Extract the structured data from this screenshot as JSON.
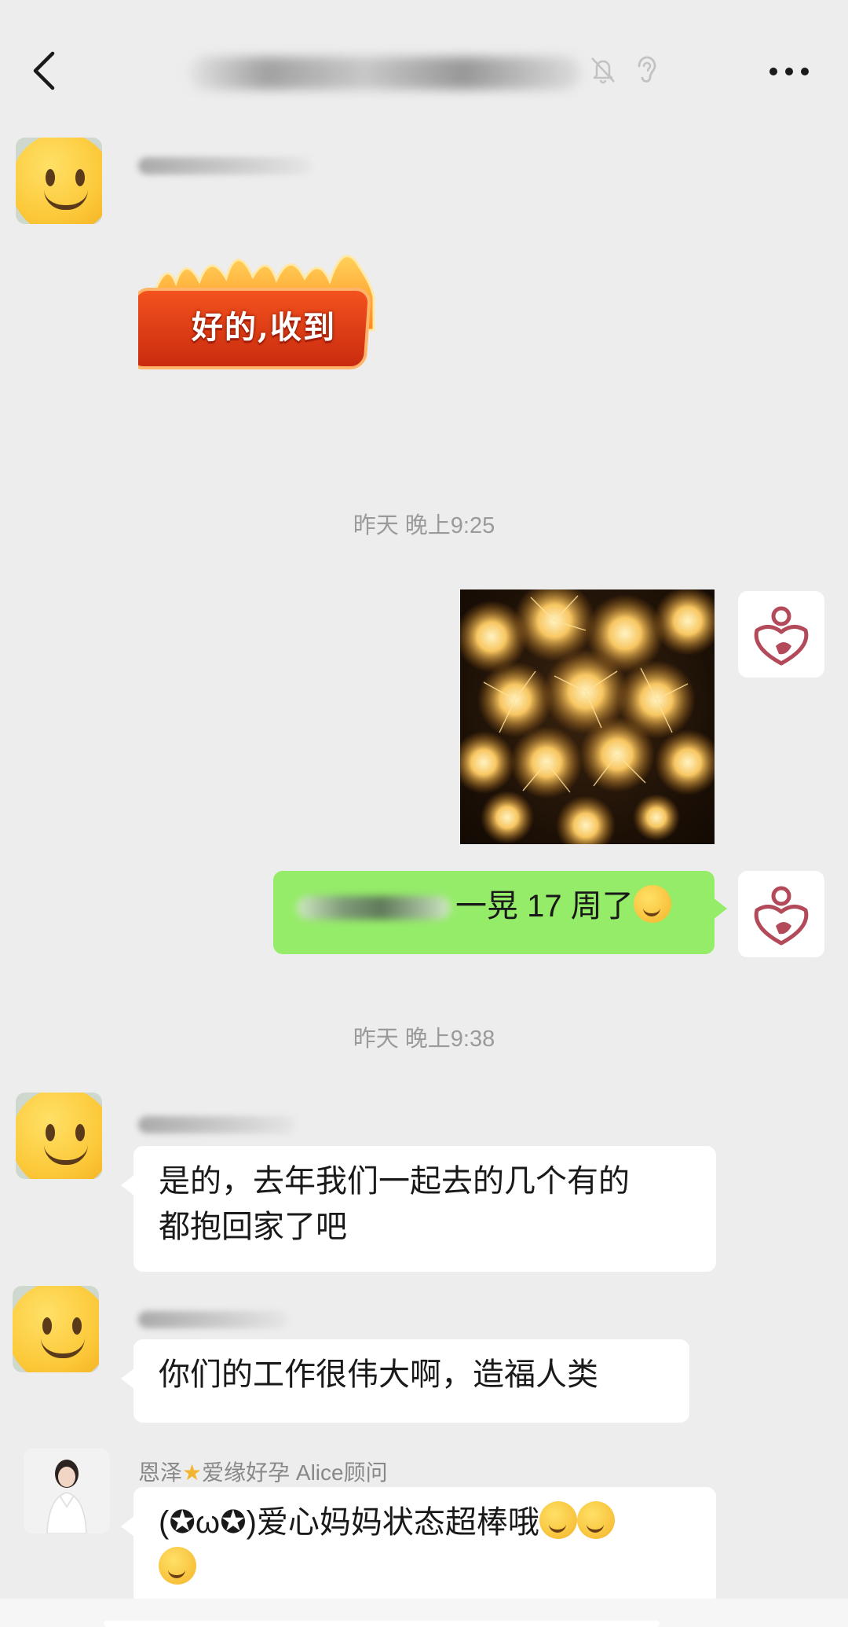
{
  "header": {
    "back_icon": "chevron-left-icon",
    "title_blurred": true,
    "status_icons": [
      "bell-muted-icon",
      "ear-icon"
    ],
    "more_icon": "more-dots-icon"
  },
  "messages": {
    "m1": {
      "type": "sticker",
      "direction": "in",
      "avatar": "smiley",
      "sticker_text": "好的,收到"
    },
    "t1": {
      "text": "昨天 晚上9:25"
    },
    "m2": {
      "type": "image",
      "direction": "out",
      "avatar": "clinic-logo",
      "image_icon": "fireworks-photo"
    },
    "m3": {
      "type": "text",
      "direction": "out",
      "avatar": "clinic-logo",
      "text": "一晃 17 周了",
      "emoji": "thinking-emoji"
    },
    "t2": {
      "text": "昨天 晚上9:38"
    },
    "m4": {
      "type": "text",
      "direction": "in",
      "avatar": "smiley",
      "line1": "是的，去年我们一起去的几个有的",
      "line2": "都抱回家了吧"
    },
    "m5": {
      "type": "text",
      "direction": "in",
      "avatar": "smiley",
      "text": "你们的工作很伟大啊，造福人类"
    },
    "m6": {
      "type": "text",
      "direction": "in",
      "avatar": "alice-portrait",
      "sender_prefix": "恩泽",
      "sender_suffix": "爱缘好孕 Alice顾问",
      "line1": "(✪ω✪)爱心妈妈状态超棒哦",
      "emoji": "shushing-face-emoji"
    }
  },
  "colors": {
    "background": "#ededed",
    "bubble_out": "#95ec69",
    "bubble_in": "#ffffff",
    "timestamp": "#9a9a9a",
    "logo_accent": "#b34a5a"
  }
}
